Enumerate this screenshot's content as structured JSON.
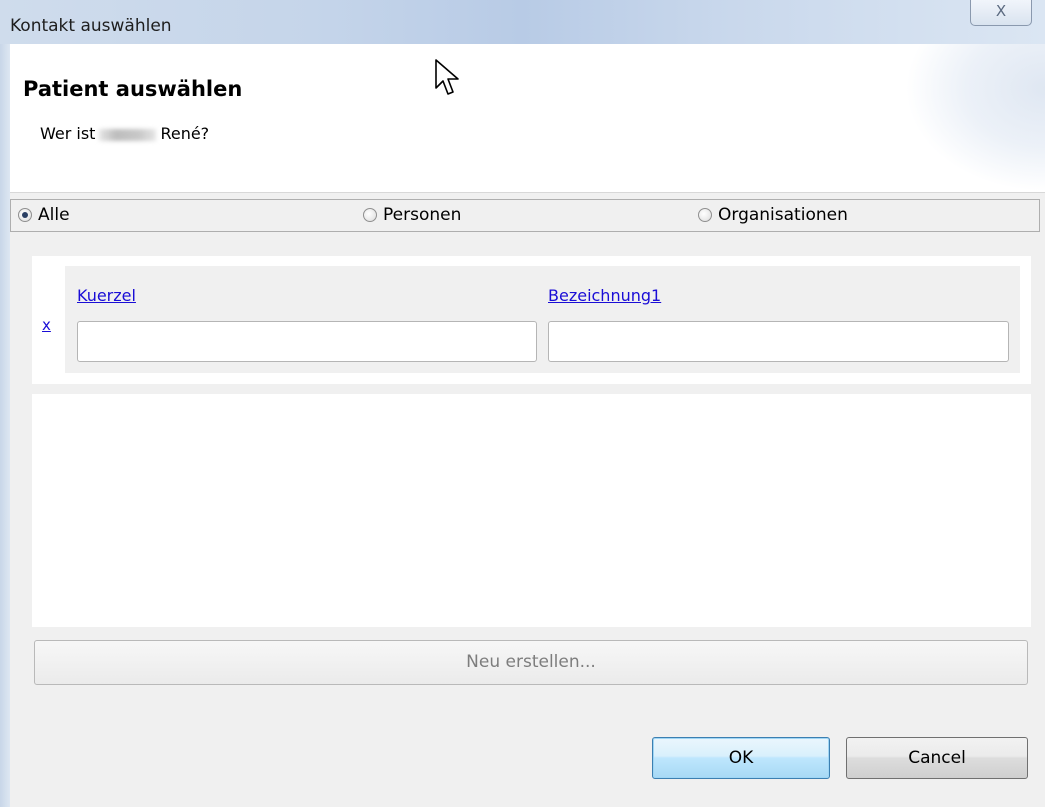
{
  "window": {
    "title": "Kontakt auswählen",
    "close_glyph": "X"
  },
  "header": {
    "title": "Patient auswählen",
    "subtitle_prefix": "Wer ist",
    "subtitle_suffix": "René?"
  },
  "filter_type": {
    "options": [
      {
        "label": "Alle",
        "checked": true
      },
      {
        "label": "Personen",
        "checked": false
      },
      {
        "label": "Organisationen",
        "checked": false
      }
    ]
  },
  "filter": {
    "clear_label": "x",
    "columns": [
      {
        "label": "Kuerzel",
        "value": ""
      },
      {
        "label": "Bezeichnung1",
        "value": ""
      }
    ]
  },
  "results": {
    "rows": []
  },
  "actions": {
    "new_label": "Neu erstellen...",
    "ok_label": "OK",
    "cancel_label": "Cancel"
  },
  "colors": {
    "link": "#1a0dd6",
    "ok_border": "#3c7fb1",
    "disabled_text": "#7d7d7d"
  }
}
